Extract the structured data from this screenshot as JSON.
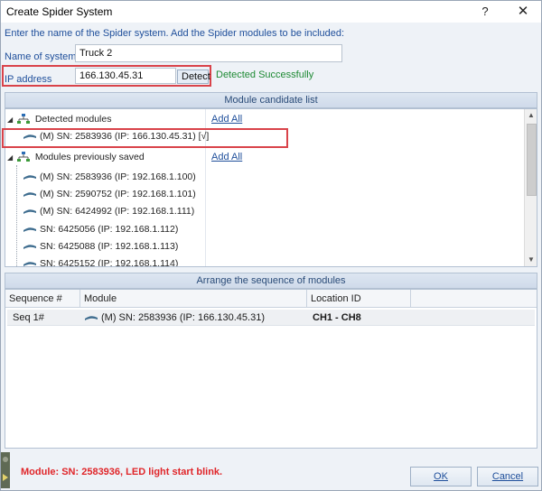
{
  "window": {
    "title": "Create Spider System",
    "help_label": "?",
    "close_label": "✕"
  },
  "instructions": "Enter the name of the Spider system. Add the Spider modules to be included:",
  "name_field": {
    "label": "Name of system",
    "value": "Truck 2"
  },
  "ip_field": {
    "label": "IP address",
    "value": "166.130.45.31",
    "detect_label": "Detect",
    "status": "Detected Successfully"
  },
  "candidates": {
    "header": "Module candidate list",
    "detected_group": {
      "label": "Detected modules",
      "add_all": "Add All",
      "items": [
        "(M) SN: 2583936 (IP: 166.130.45.31) [√]"
      ]
    },
    "saved_group": {
      "label": "Modules previously saved",
      "add_all": "Add All",
      "items": [
        "(M) SN: 2583936 (IP: 192.168.1.100)",
        "(M) SN: 2590752 (IP: 192.168.1.101)",
        "(M) SN: 6424992 (IP: 192.168.1.111)",
        "SN: 6425056 (IP: 192.168.1.112)",
        "SN: 6425088 (IP: 192.168.1.113)",
        "SN: 6425152 (IP: 192.168.1.114)"
      ]
    }
  },
  "sequence": {
    "header": "Arrange the sequence of modules",
    "columns": [
      "Sequence #",
      "Module",
      "Location ID"
    ],
    "rows": [
      {
        "seq": "Seq 1#",
        "module": "(M) SN: 2583936 (IP: 166.130.45.31)",
        "location": "CH1  -  CH8"
      }
    ]
  },
  "status_message": "Module: SN: 2583936, LED light start blink.",
  "buttons": {
    "ok": "OK",
    "cancel": "Cancel"
  },
  "colors": {
    "accent_blue": "#1f4f9b",
    "success_green": "#1e8a34",
    "highlight_red": "#d9434a",
    "status_red": "#e0262a"
  }
}
